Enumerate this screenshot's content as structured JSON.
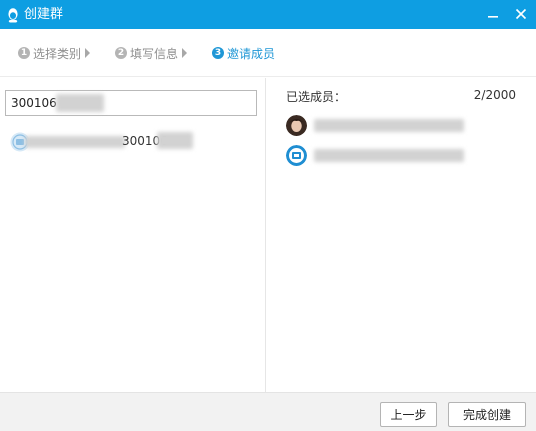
{
  "window": {
    "title": "创建群",
    "logo_icon": "qq-penguin-icon",
    "minimize_icon": "minimize-icon",
    "close_icon": "close-icon",
    "title_bar_color": "#0e9ee2"
  },
  "steps": [
    {
      "num": "1",
      "label": "选择类别",
      "state": "done"
    },
    {
      "num": "2",
      "label": "填写信息",
      "state": "done"
    },
    {
      "num": "3",
      "label": "邀请成员",
      "state": "active"
    }
  ],
  "accent_color": "#1f97d6",
  "search": {
    "value": "300106"
  },
  "results": [
    {
      "text": "300106",
      "avatar_icon": "group-avatar-icon"
    }
  ],
  "selected": {
    "header": "已选成员：",
    "count": "2/2000",
    "members": [
      {
        "avatar_icon": "user-avatar-icon"
      },
      {
        "avatar_icon": "group-avatar-icon"
      }
    ]
  },
  "footer": {
    "prev_label": "上一步",
    "finish_label": "完成创建"
  }
}
